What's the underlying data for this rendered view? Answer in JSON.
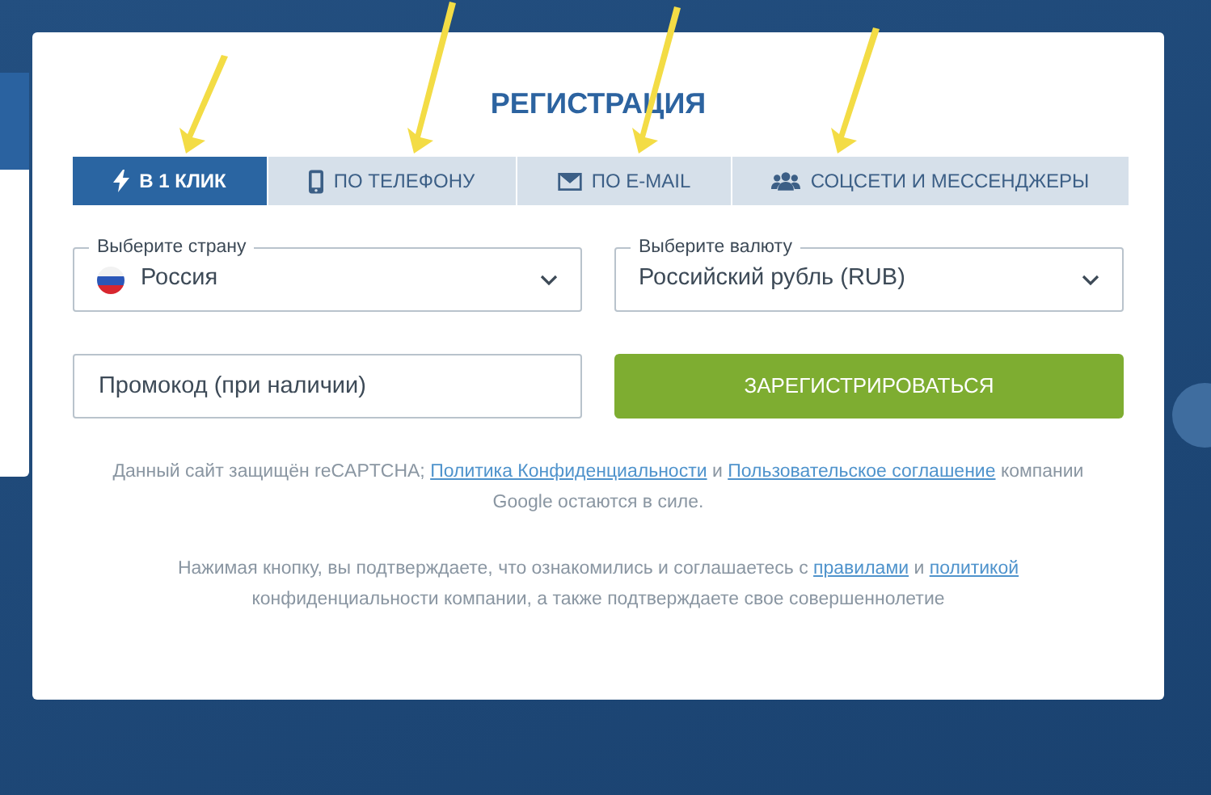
{
  "title": "РЕГИСТРАЦИЯ",
  "tabs": [
    {
      "kind": "bolt",
      "label": "В 1 КЛИК",
      "selected": true,
      "arrow": true
    },
    {
      "kind": "phone",
      "label": "ПО ТЕЛЕФОНУ",
      "selected": false,
      "arrow": true
    },
    {
      "kind": "mail",
      "label": "ПО E-MAIL",
      "selected": false,
      "arrow": true
    },
    {
      "kind": "people",
      "label": "СОЦСЕТИ И МЕССЕНДЖЕРЫ",
      "selected": false,
      "arrow": true
    }
  ],
  "country": {
    "label": "Выберите страну",
    "value": "Россия"
  },
  "currency": {
    "label": "Выберите валюту",
    "value": "Российский рубль (RUB)"
  },
  "promo": {
    "placeholder": "Промокод (при наличии)"
  },
  "register_button": "ЗАРЕГИСТРИРОВАТЬСЯ",
  "notes": [
    [
      {
        "kind": "text",
        "text": "Данный сайт защищён reCAPTCHA; "
      },
      {
        "kind": "link",
        "text": "Политика Конфиденциальности"
      },
      {
        "kind": "text",
        "text": " и "
      },
      {
        "kind": "link",
        "text": "Пользовательское соглашение"
      },
      {
        "kind": "text",
        "text": " компании Google остаются в силе."
      }
    ],
    [
      {
        "kind": "text",
        "text": "Нажимая кнопку, вы подтверждаете, что ознакомились и соглашаетесь с "
      },
      {
        "kind": "link",
        "text": "правилами"
      },
      {
        "kind": "text",
        "text": " и "
      },
      {
        "kind": "link",
        "text": "политикой"
      },
      {
        "kind": "text",
        "text": " конфиденциальности компании, а также подтверждаете свое совершеннолетие"
      }
    ]
  ]
}
